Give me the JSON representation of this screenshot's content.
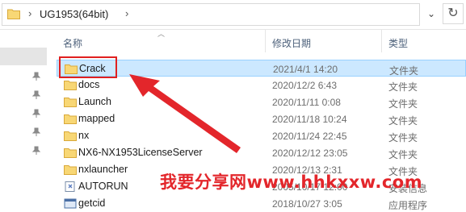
{
  "address_bar": {
    "separator": "›",
    "path": "UG1953(64bit)",
    "dropdown_glyph": "⌄",
    "refresh_glyph": "↻"
  },
  "columns": {
    "name": "名称",
    "date": "修改日期",
    "type": "类型"
  },
  "files": [
    {
      "name": "Crack",
      "date": "2021/4/1 14:20",
      "type": "文件夹",
      "icon": "folder-icon",
      "selected": true
    },
    {
      "name": "docs",
      "date": "2020/12/2 6:43",
      "type": "文件夹",
      "icon": "folder-icon"
    },
    {
      "name": "Launch",
      "date": "2020/11/11 0:08",
      "type": "文件夹",
      "icon": "folder-icon"
    },
    {
      "name": "mapped",
      "date": "2020/11/18 10:24",
      "type": "文件夹",
      "icon": "folder-icon"
    },
    {
      "name": "nx",
      "date": "2020/11/24 22:45",
      "type": "文件夹",
      "icon": "folder-icon"
    },
    {
      "name": "NX6-NX1953LicenseServer",
      "date": "2020/12/12 23:05",
      "type": "文件夹",
      "icon": "folder-icon"
    },
    {
      "name": "nxlauncher",
      "date": "2020/12/13 2:31",
      "type": "文件夹",
      "icon": "folder-icon"
    },
    {
      "name": "AUTORUN",
      "date": "2005/10/17 12:00",
      "type": "安装信息",
      "icon": "setup-info-icon"
    },
    {
      "name": "getcid",
      "date": "2018/10/27 3:05",
      "type": "应用程序",
      "icon": "application-icon"
    }
  ],
  "watermark": "我要分享网www.hhkxxw.com",
  "colors": {
    "selection_bg": "#cce8ff",
    "annotation_red": "#e3262b",
    "folder_yellow": "#f8d775"
  }
}
